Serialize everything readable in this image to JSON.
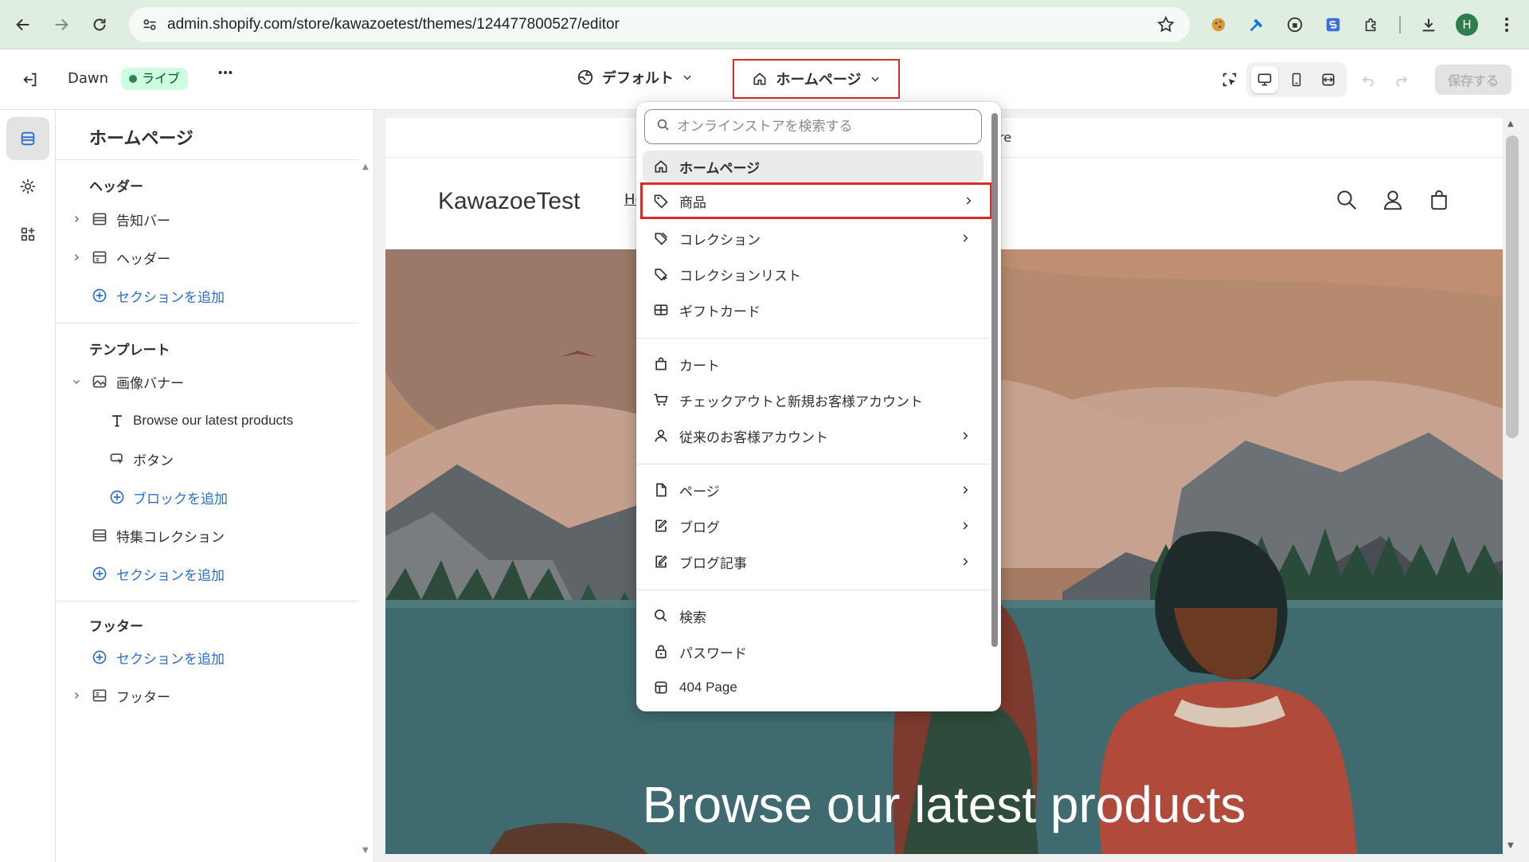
{
  "browser": {
    "url": "admin.shopify.com/store/kawazoetest/themes/124477800527/editor",
    "profile_initial": "H"
  },
  "topbar": {
    "theme_name": "Dawn",
    "live_badge": "ライブ",
    "template_label": "デフォルト",
    "page_label": "ホームページ",
    "save_label": "保存する"
  },
  "sidebar": {
    "title": "ホームページ",
    "header_group": {
      "heading": "ヘッダー",
      "items": [
        {
          "label": "告知バー",
          "icon": "section-icon"
        },
        {
          "label": "ヘッダー",
          "icon": "header-section-icon"
        }
      ],
      "add_section": "セクションを追加"
    },
    "template_group": {
      "heading": "テンプレート",
      "section": {
        "label": "画像バナー",
        "icon": "image-section-icon"
      },
      "blocks": [
        {
          "label": "Browse our latest products",
          "icon": "text-icon"
        },
        {
          "label": "ボタン",
          "icon": "button-icon"
        }
      ],
      "add_block": "ブロックを追加",
      "featured": {
        "label": "特集コレクション",
        "icon": "section-icon"
      },
      "add_section": "セクションを追加"
    },
    "footer_group": {
      "heading": "フッター",
      "add_section": "セクションを追加",
      "footer": {
        "label": "フッター",
        "icon": "footer-section-icon"
      }
    }
  },
  "dropdown": {
    "search_placeholder": "オンラインストアを検索する",
    "items": [
      {
        "label": "ホームページ",
        "icon": "home-icon",
        "submenu": false,
        "selected": true
      },
      {
        "label": "商品",
        "icon": "tag-icon",
        "submenu": true,
        "highlight": true
      },
      {
        "label": "コレクション",
        "icon": "collection-icon",
        "submenu": true
      },
      {
        "label": "コレクションリスト",
        "icon": "collection-list-icon",
        "submenu": false
      },
      {
        "label": "ギフトカード",
        "icon": "gift-card-icon",
        "submenu": false
      },
      {
        "label": "カート",
        "icon": "bag-icon",
        "submenu": false
      },
      {
        "label": "チェックアウトと新規お客様アカウント",
        "icon": "cart-icon",
        "submenu": false
      },
      {
        "label": "従来のお客様アカウント",
        "icon": "person-icon",
        "submenu": true
      },
      {
        "label": "ページ",
        "icon": "page-icon",
        "submenu": true
      },
      {
        "label": "ブログ",
        "icon": "blog-icon",
        "submenu": true
      },
      {
        "label": "ブログ記事",
        "icon": "blog-post-icon",
        "submenu": true
      },
      {
        "label": "検索",
        "icon": "search-icon",
        "submenu": false
      },
      {
        "label": "パスワード",
        "icon": "lock-icon",
        "submenu": false
      },
      {
        "label": "404 Page",
        "icon": "page-404-icon",
        "submenu": false
      }
    ]
  },
  "preview": {
    "announcement_fragment": "re",
    "store_name": "KawazoeTest",
    "nav_fragment": "Ho",
    "banner_heading": "Browse our latest products"
  },
  "colors": {
    "accent_red": "#d72c2c",
    "link_blue": "#2c6ecb",
    "live_green": "#29845a"
  }
}
